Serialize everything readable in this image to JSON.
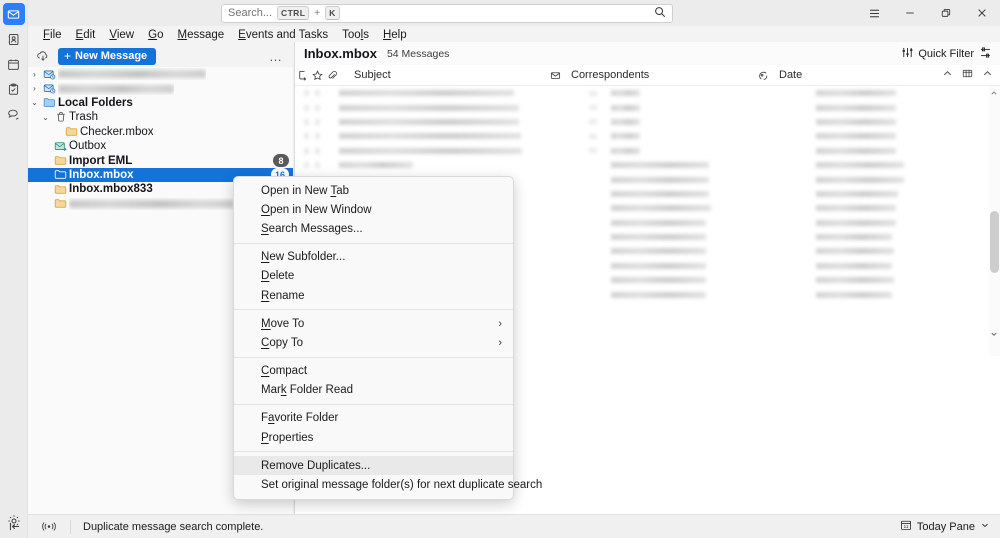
{
  "window": {
    "controls": [
      {
        "name": "app-menu-button",
        "icon": "hamburger-icon",
        "label": "☰"
      },
      {
        "name": "minimize-button",
        "icon": "minimize-icon",
        "label": "–"
      },
      {
        "name": "restore-button",
        "icon": "restore-icon",
        "label": "❐"
      },
      {
        "name": "close-button",
        "icon": "close-icon",
        "label": "✕"
      }
    ]
  },
  "search": {
    "placeholder": "Search...",
    "shortcut_key1": "CTRL",
    "shortcut_plus": "+",
    "shortcut_key2": "K",
    "icon": "search-icon"
  },
  "menubar": {
    "items": [
      {
        "pre": "",
        "accel": "F",
        "post": "ile"
      },
      {
        "pre": "",
        "accel": "E",
        "post": "dit"
      },
      {
        "pre": "",
        "accel": "V",
        "post": "iew"
      },
      {
        "pre": "",
        "accel": "G",
        "post": "o"
      },
      {
        "pre": "",
        "accel": "M",
        "post": "essage"
      },
      {
        "pre": "",
        "accel": "E",
        "post": "vents and Tasks"
      },
      {
        "pre": "Too",
        "accel": "l",
        "post": "s"
      },
      {
        "pre": "",
        "accel": "H",
        "post": "elp"
      }
    ]
  },
  "rail": {
    "top_items": [
      {
        "name": "mail-tab",
        "icon": "mail-icon",
        "active": true
      },
      {
        "name": "address-book-tab",
        "icon": "address-book-icon",
        "active": false
      },
      {
        "name": "calendar-tab",
        "icon": "calendar-icon",
        "active": false
      },
      {
        "name": "tasks-tab",
        "icon": "tasks-icon",
        "active": false
      },
      {
        "name": "chat-tab",
        "icon": "chat-icon",
        "active": false
      }
    ],
    "bottom_items": [
      {
        "name": "settings-button",
        "icon": "gear-icon"
      },
      {
        "name": "collapse-rail-button",
        "icon": "collapse-left-icon"
      }
    ]
  },
  "folder_toolbar": {
    "cloud_icon": "cloud-sync-icon",
    "new_message_label": "New Message",
    "new_message_plus": "+",
    "new_message_color": "#1373d9",
    "overflow_label": "…"
  },
  "folder_tree": {
    "rows": [
      {
        "indent": 0,
        "twisty": "›",
        "icon": "account-mail-icon",
        "label": "",
        "redacted": true,
        "redact_width": 148,
        "bold": false,
        "selected": false,
        "badge": ""
      },
      {
        "indent": 0,
        "twisty": "›",
        "icon": "account-mail-icon",
        "label": "",
        "redacted": true,
        "redact_width": 116,
        "bold": false,
        "selected": false,
        "badge": ""
      },
      {
        "indent": 0,
        "twisty": "⌄",
        "icon": "folder-open-icon",
        "label": "Local Folders",
        "redacted": false,
        "bold": true,
        "selected": false,
        "badge": ""
      },
      {
        "indent": 1,
        "twisty": "⌄",
        "icon": "trash-icon",
        "label": "Trash",
        "redacted": false,
        "bold": false,
        "selected": false,
        "badge": ""
      },
      {
        "indent": 2,
        "twisty": "",
        "icon": "folder-icon",
        "label": "Checker.mbox",
        "redacted": false,
        "bold": false,
        "selected": false,
        "badge": ""
      },
      {
        "indent": 1,
        "twisty": "",
        "icon": "outbox-icon",
        "label": "Outbox",
        "redacted": false,
        "bold": false,
        "selected": false,
        "badge": ""
      },
      {
        "indent": 1,
        "twisty": "",
        "icon": "folder-icon",
        "label": "Import EML",
        "redacted": false,
        "bold": true,
        "selected": false,
        "badge": "8",
        "badge_style": "gray"
      },
      {
        "indent": 1,
        "twisty": "",
        "icon": "folder-icon",
        "label": "Inbox.mbox",
        "redacted": false,
        "bold": true,
        "selected": true,
        "badge": "16",
        "badge_style": "white"
      },
      {
        "indent": 1,
        "twisty": "",
        "icon": "folder-icon",
        "label": "Inbox.mbox833",
        "redacted": false,
        "bold": true,
        "selected": false,
        "badge": ""
      },
      {
        "indent": 1,
        "twisty": "",
        "icon": "folder-icon",
        "label": ".m",
        "redacted": true,
        "redact_width": 165,
        "bold": false,
        "selected": false,
        "badge": ""
      }
    ]
  },
  "message_pane": {
    "folder_title": "Inbox.mbox",
    "message_count": "54 Messages",
    "quick_filter_label": "Quick Filter",
    "quick_filter_icon": "filter-sliders-icon",
    "column_options_icon": "column-options-icon",
    "columns": [
      {
        "name": "thread-column",
        "icon": "thread-icon",
        "label": ""
      },
      {
        "name": "starred-column",
        "icon": "star-icon",
        "label": ""
      },
      {
        "name": "attachment-column",
        "icon": "paperclip-icon",
        "label": ""
      },
      {
        "name": "subject-column",
        "icon": "",
        "label": "Subject"
      },
      {
        "name": "unread-column",
        "icon": "envelope-icon",
        "label": ""
      },
      {
        "name": "correspondents-column",
        "icon": "",
        "label": "Correspondents"
      },
      {
        "name": "junk-column",
        "icon": "junk-icon",
        "label": ""
      },
      {
        "name": "date-column",
        "icon": "",
        "label": "Date"
      }
    ],
    "sort_indicator": "˄",
    "select-columns-icon": "select-columns-icon",
    "rows": [
      {
        "subject_w": 175,
        "corr_w": 29,
        "date_w": 80,
        "has_att": true
      },
      {
        "subject_w": 180,
        "corr_w": 29,
        "date_w": 80,
        "has_att": true
      },
      {
        "subject_w": 180,
        "corr_w": 29,
        "date_w": 80,
        "has_att": true
      },
      {
        "subject_w": 182,
        "corr_w": 29,
        "date_w": 80,
        "has_att": true
      },
      {
        "subject_w": 183,
        "corr_w": 29,
        "date_w": 80,
        "has_att": true
      },
      {
        "subject_w": 74,
        "corr_w": 98,
        "date_w": 88,
        "has_att": false
      },
      {
        "subject_w": 0,
        "corr_w": 98,
        "date_w": 88,
        "has_att": false
      },
      {
        "subject_w": 0,
        "corr_w": 98,
        "date_w": 82,
        "has_att": false
      },
      {
        "subject_w": 0,
        "corr_w": 100,
        "date_w": 80,
        "has_att": false
      },
      {
        "subject_w": 0,
        "corr_w": 95,
        "date_w": 80,
        "has_att": false
      },
      {
        "subject_w": 0,
        "corr_w": 95,
        "date_w": 76,
        "has_att": false
      },
      {
        "subject_w": 0,
        "corr_w": 95,
        "date_w": 78,
        "has_att": false
      },
      {
        "subject_w": 0,
        "corr_w": 95,
        "date_w": 76,
        "has_att": false
      },
      {
        "subject_w": 0,
        "corr_w": 95,
        "date_w": 78,
        "has_att": false
      },
      {
        "subject_w": 0,
        "corr_w": 95,
        "date_w": 76,
        "has_att": false
      }
    ]
  },
  "context_menu": {
    "items": [
      {
        "type": "item",
        "pre": "Open in New ",
        "accel": "T",
        "post": "ab",
        "submenu": false,
        "highlighted": false,
        "name": "open-in-new-tab"
      },
      {
        "type": "item",
        "pre": "",
        "accel": "O",
        "post": "pen in New Window",
        "submenu": false,
        "highlighted": false,
        "name": "open-in-new-window"
      },
      {
        "type": "item",
        "pre": "",
        "accel": "S",
        "post": "earch Messages...",
        "submenu": false,
        "highlighted": false,
        "name": "search-messages"
      },
      {
        "type": "sep"
      },
      {
        "type": "item",
        "pre": "",
        "accel": "N",
        "post": "ew Subfolder...",
        "submenu": false,
        "highlighted": false,
        "name": "new-subfolder"
      },
      {
        "type": "item",
        "pre": "",
        "accel": "D",
        "post": "elete",
        "submenu": false,
        "highlighted": false,
        "name": "delete-folder"
      },
      {
        "type": "item",
        "pre": "",
        "accel": "R",
        "post": "ename",
        "submenu": false,
        "highlighted": false,
        "name": "rename-folder"
      },
      {
        "type": "sep"
      },
      {
        "type": "item",
        "pre": "",
        "accel": "M",
        "post": "ove To",
        "submenu": true,
        "highlighted": false,
        "name": "move-to"
      },
      {
        "type": "item",
        "pre": "",
        "accel": "C",
        "post": "opy To",
        "submenu": true,
        "highlighted": false,
        "name": "copy-to"
      },
      {
        "type": "sep"
      },
      {
        "type": "item",
        "pre": "",
        "accel": "C",
        "post": "ompact",
        "submenu": false,
        "highlighted": false,
        "name": "compact"
      },
      {
        "type": "item",
        "pre": "Mar",
        "accel": "k",
        "post": " Folder Read",
        "submenu": false,
        "highlighted": false,
        "name": "mark-folder-read"
      },
      {
        "type": "sep"
      },
      {
        "type": "item",
        "pre": "F",
        "accel": "a",
        "post": "vorite Folder",
        "submenu": false,
        "highlighted": false,
        "name": "favorite-folder"
      },
      {
        "type": "item",
        "pre": "",
        "accel": "P",
        "post": "roperties",
        "submenu": false,
        "highlighted": false,
        "name": "properties"
      },
      {
        "type": "sep"
      },
      {
        "type": "item",
        "pre": "Remove Duplicates...",
        "accel": "",
        "post": "",
        "submenu": false,
        "highlighted": true,
        "name": "remove-duplicates"
      },
      {
        "type": "item",
        "pre": "Set original message folder(s) for next duplicate search",
        "accel": "",
        "post": "",
        "submenu": false,
        "highlighted": false,
        "name": "set-original-message-folders"
      }
    ],
    "submenu_arrow": "›"
  },
  "statusbar": {
    "activity_icon": "activity-signal-icon",
    "message": "Duplicate message search complete.",
    "today_pane_label": "Today Pane",
    "today_pane_icon": "calendar-11-icon",
    "today_pane_chevron": "⌄"
  }
}
